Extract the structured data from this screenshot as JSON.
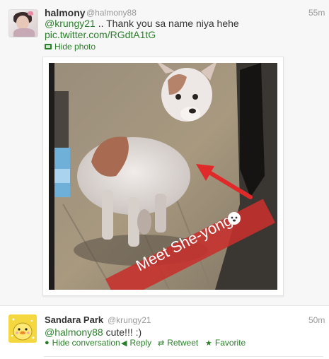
{
  "tweets": [
    {
      "name": "halmony",
      "handle": "@halmony88",
      "time": "55m",
      "mention": "@krungy21",
      "text": " .. Thank you sa name niya hehe",
      "link": "pic.twitter.com/RGdtA1tG",
      "actions": {
        "hide_photo": "Hide photo"
      },
      "photo": {
        "caption": "Meet She-yong"
      }
    },
    {
      "name": "Sandara Park",
      "handle": "@krungy21",
      "time": "50m",
      "mention": "@halmony88",
      "text": " cute!!! :)",
      "actions": {
        "hide_conversation": "Hide conversation",
        "reply": "Reply",
        "retweet": "Retweet",
        "favorite": "Favorite"
      }
    }
  ],
  "colors": {
    "link": "#2a7f2a",
    "photo_border": "#e2e2e2",
    "caption_bg": "#c7302c"
  }
}
